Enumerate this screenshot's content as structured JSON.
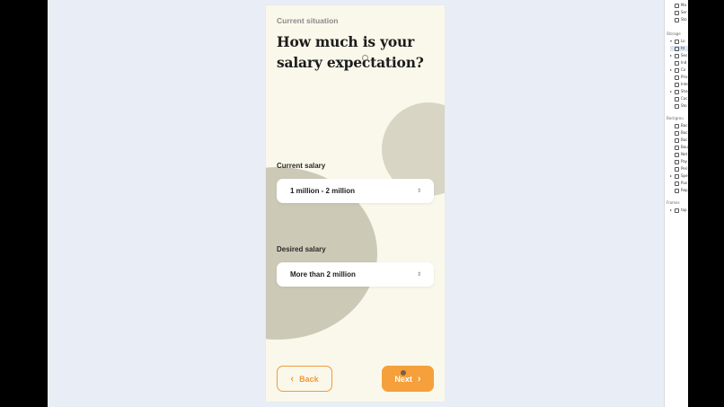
{
  "screen": {
    "eyebrow": "Current situation",
    "headline": "How much is your salary expectation?",
    "current_salary": {
      "label": "Current salary",
      "value": "1 million - 2 million"
    },
    "desired_salary": {
      "label": "Desired salary",
      "value": "More than 2 million"
    },
    "back_button": "Back",
    "next_button": "Next"
  },
  "devtools": {
    "top_rows": [
      "Ma",
      "Ser",
      "Sto"
    ],
    "storage": {
      "label": "Storage",
      "rows": [
        "Lo",
        "ht",
        "Ses",
        "Ind",
        "Co",
        "Priv",
        "Inte",
        "Sha",
        "Cac",
        "Sto"
      ]
    },
    "background": {
      "label": "Backgrou",
      "rows": [
        "Bac",
        "Bac",
        "Bac",
        "Bou",
        "Not",
        "Pay",
        "Peri",
        "Spe",
        "Pus",
        "Rep"
      ]
    },
    "frames": {
      "label": "Frames",
      "rows": [
        "top"
      ]
    }
  },
  "colors": {
    "accent": "#f5a03a",
    "card_background": "#faf8eb",
    "page_background": "#e9edf6",
    "circle": "#cdc9b7"
  }
}
